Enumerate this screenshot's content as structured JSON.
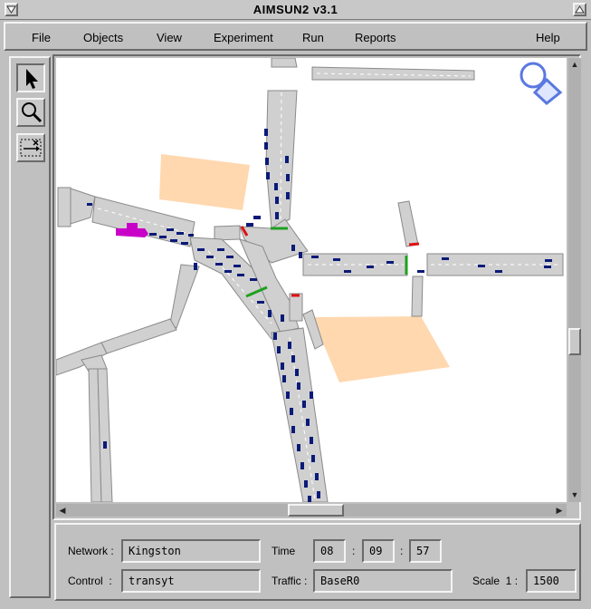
{
  "window": {
    "title": "AIMSUN2 v3.1"
  },
  "menu": {
    "items": [
      {
        "label": "File"
      },
      {
        "label": "Objects"
      },
      {
        "label": "View"
      },
      {
        "label": "Experiment"
      },
      {
        "label": "Run"
      },
      {
        "label": "Reports"
      }
    ],
    "help": "Help"
  },
  "tools": [
    "arrow-icon",
    "magnifier-icon",
    "link-icon"
  ],
  "info": {
    "network_label": "Network",
    "network_value": "Kingston",
    "control_label": "Control",
    "control_value": "transyt",
    "time_label": "Time",
    "time_h": "08",
    "time_m": "09",
    "time_s": "57",
    "traffic_label": "Traffic",
    "traffic_value": "BaseR0",
    "scale_label": "Scale  1 :",
    "scale_value": "1500"
  },
  "colors": {
    "road": "#d0d0d0",
    "vehicle": "#0a1a78",
    "vehicle_selected": "#c800c8",
    "block": "#ffd8b0",
    "signal_green": "#1ea01e",
    "signal_red": "#e01010",
    "logo": "#5a78e0"
  }
}
